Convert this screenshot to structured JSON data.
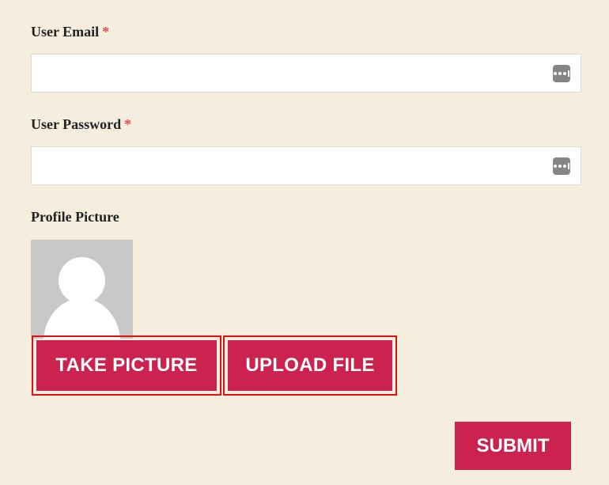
{
  "form": {
    "email": {
      "label": "User Email",
      "required_mark": "*",
      "value": "",
      "placeholder": ""
    },
    "password": {
      "label": "User Password",
      "required_mark": "*",
      "value": "",
      "placeholder": ""
    },
    "profile_picture": {
      "label": "Profile Picture",
      "take_picture_label": "TAKE PICTURE",
      "upload_file_label": "UPLOAD FILE"
    },
    "submit_label": "SUBMIT"
  },
  "icons": {
    "password_manager": "password-manager-icon",
    "avatar": "avatar-placeholder-icon"
  },
  "colors": {
    "background": "#f5eedf",
    "accent": "#cc2250",
    "highlight_border": "#e0120f",
    "required": "#e04a4a"
  }
}
